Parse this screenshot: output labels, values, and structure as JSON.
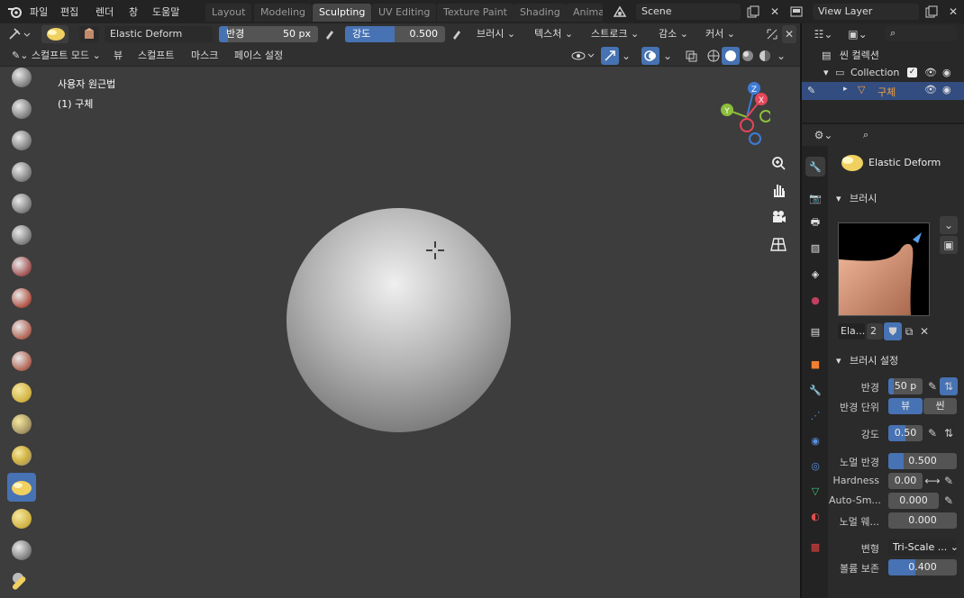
{
  "topbar": {
    "menus": [
      "파일",
      "편집",
      "렌더",
      "창",
      "도움말"
    ],
    "workspaces": [
      "Layout",
      "Modeling",
      "Sculpting",
      "UV Editing",
      "Texture Paint",
      "Shading",
      "Animat"
    ],
    "scene": "Scene",
    "view_layer": "View Layer"
  },
  "tool_header": {
    "brush_name": "Elastic Deform",
    "radius": {
      "label": "반경",
      "value": "50 px"
    },
    "strength": {
      "label": "강도",
      "value": "0.500"
    },
    "dropdowns": [
      "브러시",
      "텍스처",
      "스트로크",
      "감소",
      "커서"
    ]
  },
  "viewport_header": {
    "mode": "스컬프트 모드",
    "menus": [
      "뷰",
      "스컬프트",
      "마스크",
      "페이스 설정"
    ]
  },
  "viewport": {
    "title": "사용자 원근법",
    "object": "(1) 구체",
    "gizmo": {
      "z": "Z",
      "y": "Y",
      "x": "X"
    }
  },
  "outliner": {
    "scene_collection": "씬 컬렉션",
    "collection": "Collection",
    "object": "구체"
  },
  "properties": {
    "brush_name": "Elastic Deform",
    "brush_panel": "브러시",
    "brush_datablock": "Ela...",
    "brush_users": "2",
    "settings_panel": "브러시 설정",
    "rows": {
      "radius": {
        "label": "반경",
        "value": "50 p"
      },
      "radius_unit": {
        "label": "반경 단위",
        "opt1": "뷰",
        "opt2": "씬"
      },
      "strength": {
        "label": "강도",
        "value": "0.50"
      },
      "normal_radius": {
        "label": "노멀 반경",
        "value": "0.500"
      },
      "hardness": {
        "label": "Hardness",
        "value": "0.00"
      },
      "autosmooth": {
        "label": "Auto-Sm...",
        "value": "0.000"
      },
      "normal_weight": {
        "label": "노멀 웨...",
        "value": "0.000"
      },
      "deform": {
        "label": "변형",
        "value": "Tri-Scale ..."
      },
      "volume": {
        "label": "볼륨 보존",
        "value": "0.400"
      }
    }
  },
  "colors": {
    "accent": "#4772b3",
    "x_axis": "#e6475a",
    "y_axis": "#8cbf3a",
    "z_axis": "#3f7bd6"
  }
}
